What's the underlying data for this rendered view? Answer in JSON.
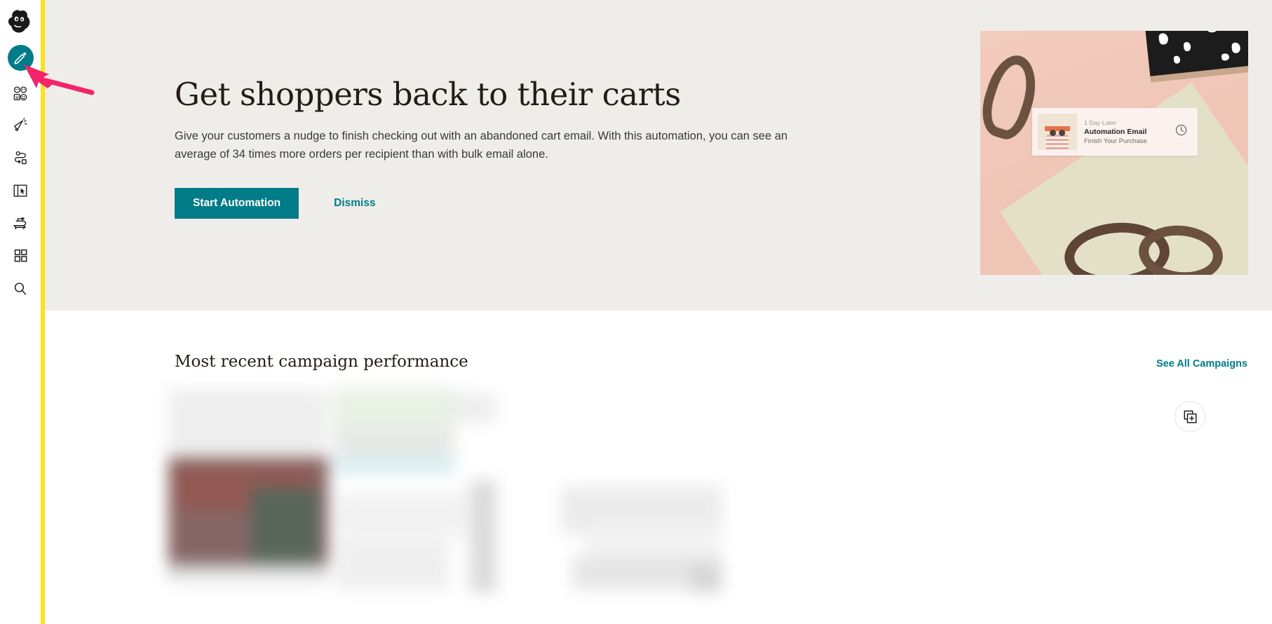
{
  "colors": {
    "accent_yellow": "#FFE01B",
    "teal": "#007C89",
    "hero_bg": "#EFEDE9",
    "arrow_pink": "#F2256A",
    "page_bg": "#FFFFFF",
    "text_dark": "#241C15"
  },
  "sidebar": {
    "logo": "mailchimp-freddie-logo",
    "create_button": {
      "label": "Create",
      "icon": "pencil-icon"
    },
    "items": [
      {
        "label": "Audience",
        "icon": "audience-faces-icon"
      },
      {
        "label": "Campaigns",
        "icon": "megaphone-icon"
      },
      {
        "label": "Automations",
        "icon": "journey-path-icon"
      },
      {
        "label": "Website",
        "icon": "website-panel-cursor-icon"
      },
      {
        "label": "Content",
        "icon": "printing-press-icon"
      },
      {
        "label": "Integrations",
        "icon": "grid-squares-icon"
      },
      {
        "label": "Search",
        "icon": "search-magnifier-icon"
      }
    ]
  },
  "annotation": {
    "arrow": "pink-arrow-pointing-to-create-button"
  },
  "hero": {
    "title": "Get shoppers back to their carts",
    "body": "Give your customers a nudge to finish checking out with an abandoned cart email. With this automation, you can see an average of 34 times more orders per recipient than with bulk email alone.",
    "primary_button": "Start Automation",
    "dismiss_link": "Dismiss",
    "image": {
      "alt": "abandoned-cart-automation-promo-photo",
      "card": {
        "eyebrow": "1 Day Later",
        "title": "Automation Email",
        "subtitle": "Finish Your Purchase",
        "icon": "clock-icon"
      }
    }
  },
  "campaign_section": {
    "title": "Most recent campaign performance",
    "see_all_link": "See All Campaigns",
    "replicate_button_icon": "replicate-duplicate-icon",
    "preview_state": "blurred-redacted-campaign-preview"
  }
}
